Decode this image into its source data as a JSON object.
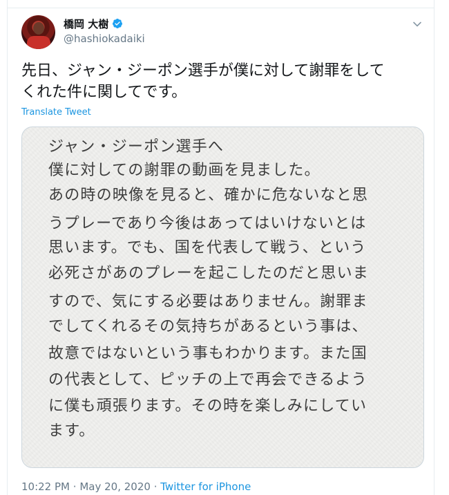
{
  "user": {
    "display_name": "橋岡 大樹",
    "handle": "@hashiokadaiki"
  },
  "tweet": {
    "text_lines": [
      "先日、ジャン・ジーポン選手が僕に対して謝罪をして",
      "くれた件に関してです。"
    ],
    "translate_label": "Translate Tweet"
  },
  "image_text": {
    "lines": [
      "ジャン・ジーポン選手へ",
      "僕に対しての謝罪の動画を見ました。",
      "あの時の映像を見ると、確かに危ないなと思",
      "うプレーであり今後はあってはいけないとは",
      "思います。でも、国を代表して戦う、という",
      "必死さがあのプレーを起こしたのだと思いま",
      "すので、気にする必要はありません。謝罪ま",
      "でしてくれるその気持ちがあるという事は、",
      "故意ではないという事もわかります。また国",
      "の代表として、ピッチの上で再会できるよう",
      "に僕も頑張ります。その時を楽しみにしてい",
      "ます。"
    ]
  },
  "meta": {
    "time": "10:22 PM",
    "separator": "·",
    "date": "May 20, 2020",
    "source": "Twitter for iPhone"
  },
  "icons": {
    "verified": "verified-badge-icon",
    "caret": "chevron-down-icon"
  },
  "colors": {
    "link": "#1b95e0",
    "secondary_text": "#657786",
    "primary_text": "#14171a",
    "verified": "#1da1f2"
  }
}
